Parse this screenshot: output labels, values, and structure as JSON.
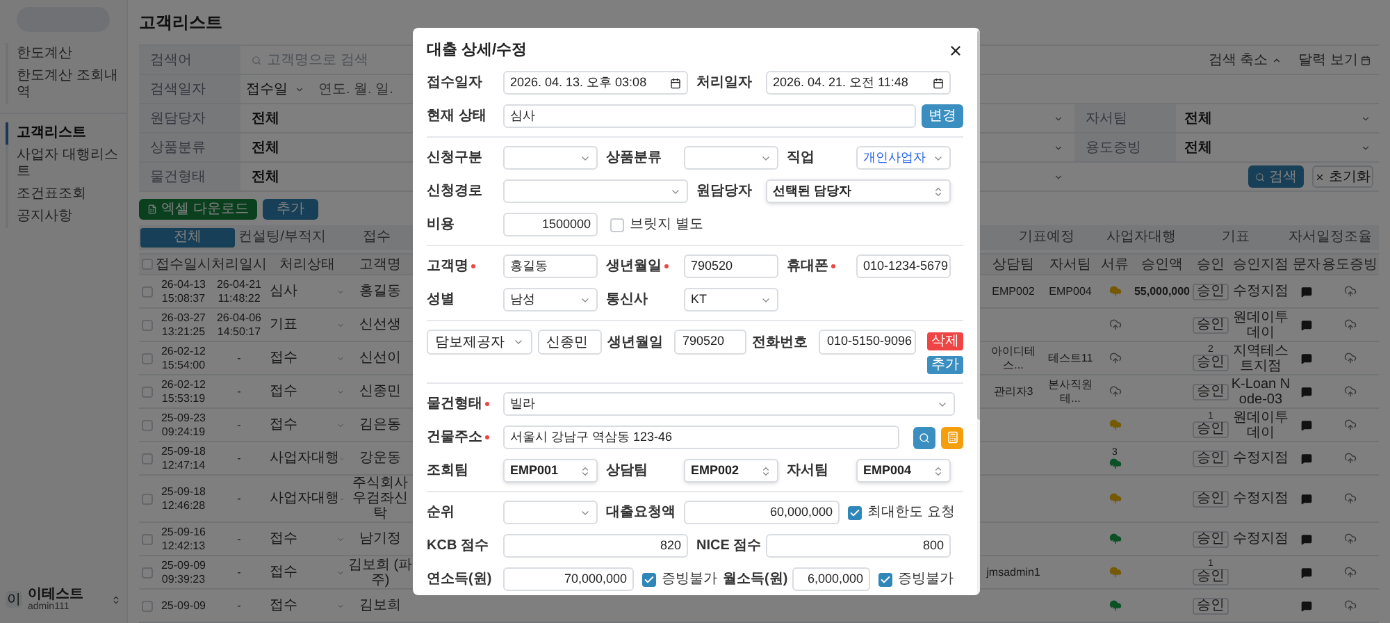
{
  "sidebar": {
    "menu_groups": [
      [
        {
          "label": "한도계산",
          "selected": false
        },
        {
          "label": "한도계산 조회내역",
          "selected": false
        }
      ],
      [
        {
          "label": "고객리스트",
          "selected": true
        },
        {
          "label": "사업자 대행리스트",
          "selected": false
        },
        {
          "label": "조건표조회",
          "selected": false
        },
        {
          "label": "공지사항",
          "selected": false
        }
      ]
    ],
    "user": {
      "initial": "이",
      "name": "이테스트",
      "id": "admin111"
    }
  },
  "page_title": "고객리스트",
  "search_panel": {
    "keyword": {
      "label": "검색어",
      "placeholder": "고객명으로 검색"
    },
    "date": {
      "label": "검색일자",
      "type": "접수일",
      "placeholder": "연도. 월. 일."
    },
    "collapse": "검색 축소",
    "calendar_view": "달력 보기",
    "filters": [
      {
        "label": "원담당자",
        "value": "전체",
        "pair": {
          "label": "자서팀",
          "value": "전체"
        }
      },
      {
        "label": "상품분류",
        "value": "전체",
        "pair": {
          "label": "용도증빙",
          "value": "전체"
        }
      },
      {
        "label": "물건형태",
        "value": "전체"
      }
    ],
    "search_button": "검색",
    "reset_button": "초기화"
  },
  "actions": [
    {
      "kind": "excel",
      "label": "엑셀 다운로드"
    },
    {
      "kind": "add",
      "label": "추가"
    }
  ],
  "status_tabs_left": [
    {
      "label": "전체",
      "selected": true
    },
    {
      "label": "컨설팅/부적지",
      "selected": false
    },
    {
      "label": "접수",
      "selected": false
    }
  ],
  "status_tabs_right": [
    {
      "label": "기표예정",
      "selected": false
    },
    {
      "label": "사업자대행",
      "selected": false
    },
    {
      "label": "기표",
      "selected": false
    },
    {
      "label": "자서일정조율",
      "selected": false
    }
  ],
  "table": {
    "all_checked": false,
    "columns_left": [
      "접수일시",
      "처리일시",
      "처리상태",
      "고객명"
    ],
    "columns_right": [
      "상담팀",
      "자서팀",
      "서류",
      "승인액",
      "승인",
      "승인지점",
      "문자",
      "용도증빙"
    ],
    "rows": [
      {
        "checked": false,
        "received": "26-04-13 15:08:37",
        "processed": "26-04-21 11:48:22",
        "status": "심사",
        "customer": "홍길동",
        "consult_team": "EMP002",
        "signing_team": "EMP004",
        "doc": {
          "kind": "gold"
        },
        "amount": "55,000,000",
        "approve": "승인",
        "branch": "수정지점"
      },
      {
        "checked": false,
        "received": "26-03-27 13:21:25",
        "processed": "26-04-06 14:50:17",
        "status": "기표",
        "customer": "신선생",
        "doc": {
          "kind": "outline"
        },
        "approve": "승인",
        "branch": "원데이투데이"
      },
      {
        "checked": false,
        "received": "26-02-12 15:54:00",
        "processed": "-",
        "status": "접수",
        "customer": "신선이",
        "consult_team": "아이디테스...",
        "signing_team": "테스트11",
        "doc": {
          "kind": "outline"
        },
        "approve_count": "2",
        "approve": "승인",
        "branch": "지역테스트지점"
      },
      {
        "checked": false,
        "received": "26-02-12 15:53:19",
        "processed": "-",
        "status": "접수",
        "customer": "신종민",
        "consult_team": "관리자3",
        "signing_team": "본사직원테...",
        "doc": {
          "kind": "outline"
        },
        "approve": "승인",
        "branch": "K-Loan Node-03"
      },
      {
        "checked": false,
        "received": "25-09-23 09:24:19",
        "processed": "-",
        "status": "접수",
        "customer": "김은동",
        "doc": {
          "kind": "gold"
        },
        "approve_count": "1",
        "approve": "승인",
        "branch": "원데이투데이"
      },
      {
        "checked": false,
        "received": "25-09-18 12:47:14",
        "processed": "-",
        "status": "사업자대행",
        "customer": "강운동",
        "doc": {
          "kind": "green"
        },
        "doc_count": "3",
        "approve": "승인",
        "branch": "수정지점"
      },
      {
        "checked": false,
        "received": "25-09-18 12:46:28",
        "processed": "-",
        "status": "사업자대행",
        "customer": "주식회사우검좌신탁",
        "doc": {
          "kind": "gold"
        },
        "approve": "승인",
        "branch": "수정지점"
      },
      {
        "checked": false,
        "received": "25-09-16 12:42:13",
        "processed": "-",
        "status": "접수",
        "customer": "남기정",
        "doc": {
          "kind": "green"
        },
        "approve": "승인",
        "branch": "수정지점"
      },
      {
        "checked": false,
        "received": "25-09-09 09:39:23",
        "processed": "-",
        "status": "접수",
        "customer": "김보희 (파주)",
        "consult_team": "jmsadmin1",
        "doc": {
          "kind": "gold"
        },
        "approve_count": "1",
        "approve": "승인"
      },
      {
        "checked": false,
        "received": "25-09-09",
        "processed": "-",
        "status": "접수",
        "customer": "김보희",
        "doc": {
          "kind": "green"
        },
        "approve": "승인"
      }
    ]
  },
  "modal": {
    "title": "대출 상세/수정",
    "sections": [
      {
        "rows": [
          {
            "kind": "pair",
            "fields": [
              {
                "kind": "date",
                "label": "접수일자",
                "value": "2026. 04. 13. 오후 03:08"
              },
              {
                "kind": "date",
                "label": "처리일자",
                "value": "2026. 04. 21. 오전 11:48"
              }
            ]
          },
          {
            "kind": "status",
            "fields": [
              {
                "kind": "readonly",
                "label": "현재 상태",
                "value": "심사"
              }
            ],
            "button": "변경"
          }
        ]
      },
      {
        "rows": [
          {
            "kind": "triple",
            "fields": [
              {
                "kind": "select",
                "label": "신청구분"
              },
              {
                "kind": "select",
                "label": "상품분류"
              },
              {
                "kind": "select",
                "label": "직업",
                "value": "개인사업자",
                "accent": true
              }
            ]
          },
          {
            "kind": "pair",
            "fields": [
              {
                "kind": "select",
                "label": "신청경로"
              },
              {
                "kind": "updown",
                "label": "원담당자",
                "value": "선택된 담당자"
              }
            ]
          },
          {
            "kind": "triple",
            "fields": [
              {
                "kind": "number",
                "label": "비용",
                "value": "1500000"
              },
              {
                "kind": "check",
                "label": "브릿지 별도",
                "checked": false
              }
            ]
          }
        ]
      },
      {
        "rows": [
          {
            "kind": "triple",
            "fields": [
              {
                "kind": "text",
                "label": "고객명",
                "required": true,
                "value": "홍길동"
              },
              {
                "kind": "text",
                "label": "생년월일",
                "required": true,
                "value": "790520"
              },
              {
                "kind": "text",
                "label": "휴대폰",
                "required": true,
                "value": "010-1234-5679"
              }
            ]
          },
          {
            "kind": "triple",
            "fields": [
              {
                "kind": "select",
                "label": "성별",
                "value": "남성"
              },
              {
                "kind": "select",
                "label": "통신사",
                "value": "KT"
              }
            ]
          }
        ]
      },
      {
        "rows": [
          {
            "kind": "guarantor",
            "role": "담보제공자",
            "name": "신종민",
            "birth_label": "생년월일",
            "birth": "790520",
            "phone_label": "전화번호",
            "phone": "010-5150-9096",
            "delete": "삭제",
            "add": "추가"
          }
        ]
      },
      {
        "rows": [
          {
            "kind": "wide",
            "fields": [
              {
                "kind": "select",
                "label": "물건형태",
                "required": true,
                "value": "빌라"
              }
            ]
          },
          {
            "kind": "address",
            "fields": [
              {
                "kind": "text",
                "label": "건물주소",
                "required": true,
                "value": "서울시 강남구 역삼동 123-46"
              }
            ]
          },
          {
            "kind": "triple",
            "fields": [
              {
                "kind": "updown",
                "label": "조회팀",
                "value": "EMP001"
              },
              {
                "kind": "updown",
                "label": "상담팀",
                "value": "EMP002"
              },
              {
                "kind": "updown",
                "label": "자서팀",
                "value": "EMP004"
              }
            ]
          }
        ]
      },
      {
        "rows": [
          {
            "kind": "request",
            "fields": [
              {
                "kind": "select",
                "label": "순위"
              },
              {
                "kind": "number",
                "label": "대출요청액",
                "value": "60,000,000"
              },
              {
                "kind": "check",
                "label": "최대한도 요청",
                "checked": true
              }
            ]
          },
          {
            "kind": "pair",
            "fields": [
              {
                "kind": "number",
                "label": "KCB 점수",
                "value": "820"
              },
              {
                "kind": "number",
                "label": "NICE 점수",
                "value": "800"
              }
            ]
          },
          {
            "kind": "income",
            "fields": [
              {
                "kind": "number",
                "label": "연소득(원)",
                "value": "70,000,000"
              },
              {
                "kind": "check",
                "label": "증빙불가",
                "checked": true
              },
              {
                "kind": "number",
                "label": "월소득(원)",
                "value": "6,000,000"
              },
              {
                "kind": "check",
                "label": "증빙불가",
                "checked": true
              }
            ]
          }
        ]
      }
    ]
  }
}
